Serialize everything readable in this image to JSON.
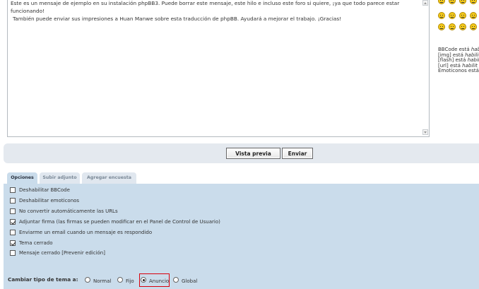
{
  "message": {
    "text_line1": "Este es un mensaje de ejemplo en su instalación phpBB3. Puede borrar este mensaje, este hilo e incluso este foro si quiere, ¡ya que todo parece estar funcionando!",
    "text_line2": "También puede enviar sus impresiones a Huan Manwe sobre esta traducción de phpBB. Ayudará a mejorar el trabajo. ¡Gracias!"
  },
  "smilies": [
    "smile",
    "wink",
    "sad",
    "surprised",
    "grin",
    "cool",
    "confused",
    "razz",
    "exclamation",
    "question",
    "idea",
    "arrow"
  ],
  "bbcode_info": {
    "line1_prefix": "BBCode está ",
    "line1_state": "hab",
    "line2_prefix": "[img] está ",
    "line2_state": "habilit",
    "line3_prefix": "[flash] está ",
    "line3_state": "habili",
    "line4_prefix": "[url] está ",
    "line4_state": "habilit",
    "line5_prefix": "Emoticonos está"
  },
  "buttons": {
    "preview_label": "Vista previa",
    "send_label": "Enviar"
  },
  "tabs": {
    "options": "Opciones",
    "attach": "Subir adjunto",
    "poll": "Agregar encuesta"
  },
  "options": [
    {
      "label": "Deshabilitar BBCode",
      "checked": false
    },
    {
      "label": "Deshabilitar emoticonos",
      "checked": false
    },
    {
      "label": "No convertir automáticamente las URLs",
      "checked": false
    },
    {
      "label": "Adjuntar firma (las firmas se pueden modificar en el Panel de Control de Usuario)",
      "checked": true
    },
    {
      "label": "Enviarme un email cuando un mensaje es respondido",
      "checked": false
    },
    {
      "label": "Tema cerrado",
      "checked": true
    },
    {
      "label": "Mensaje cerrado [Prevenir edición]",
      "checked": false
    }
  ],
  "topic_type": {
    "label": "Cambiar tipo de tema a:",
    "choices": [
      {
        "label": "Normal",
        "selected": false
      },
      {
        "label": "Fijo",
        "selected": false
      },
      {
        "label": "Anuncio",
        "selected": true
      },
      {
        "label": "Global",
        "selected": false
      }
    ]
  },
  "colors": {
    "panel_bg": "#cadceb",
    "button_bar_bg": "#e4e9ef",
    "highlight": "#d8000c"
  }
}
